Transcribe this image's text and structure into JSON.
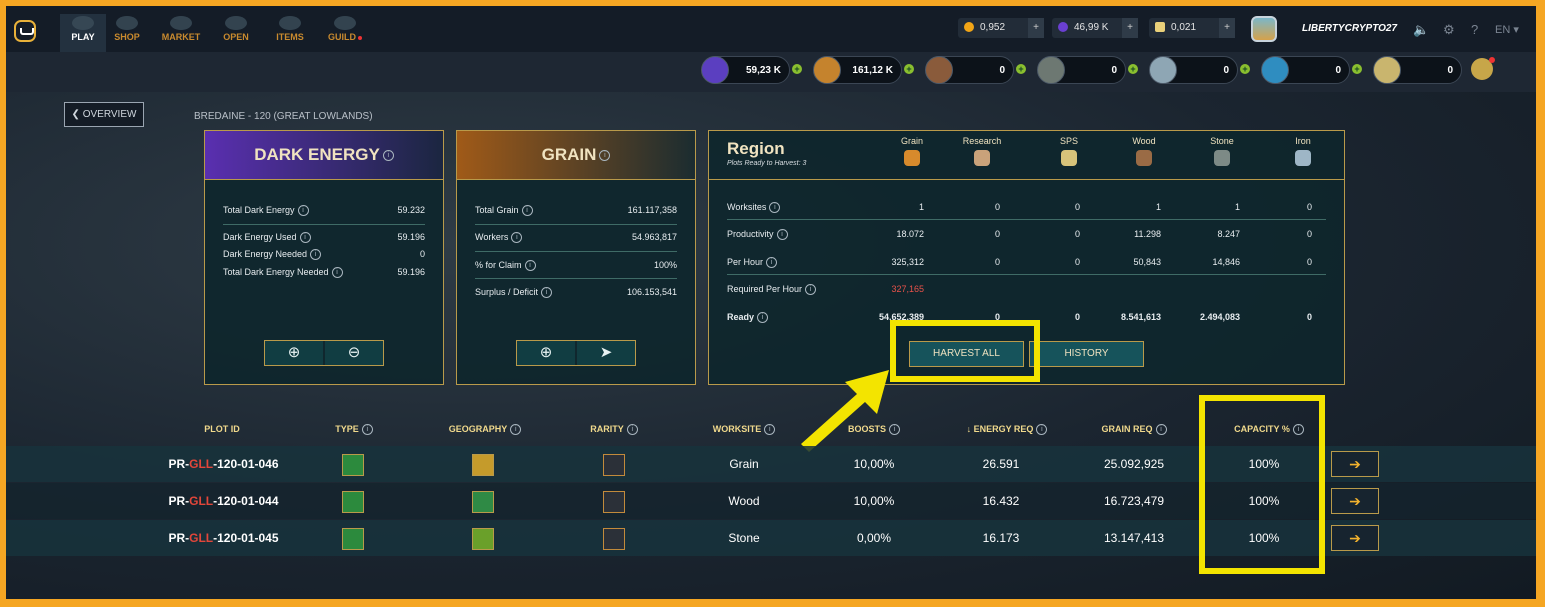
{
  "nav": {
    "items": [
      {
        "label": "PLAY",
        "active": true
      },
      {
        "label": "SHOP"
      },
      {
        "label": "MARKET"
      },
      {
        "label": "OPEN"
      },
      {
        "label": "ITEMS"
      },
      {
        "label": "GUILD"
      }
    ]
  },
  "wallet": {
    "credits": "0,952",
    "dec": "46,99 K",
    "vouchers": "0,021"
  },
  "user": {
    "name": "LIBERTYCRYPTO27",
    "language": "EN"
  },
  "subbar": {
    "back_label": "OVERVIEW",
    "breadcrumb": "BREDAINE - 120 (GREAT LOWLANDS)",
    "resources": [
      {
        "name": "dark-energy",
        "value": "59,23 K",
        "color": "#6b4fd8"
      },
      {
        "name": "grain",
        "value": "161,12 K",
        "color": "#d78a2c"
      },
      {
        "name": "wood",
        "value": "0",
        "color": "#9a6b45"
      },
      {
        "name": "stone",
        "value": "0",
        "color": "#7d8a86"
      },
      {
        "name": "iron",
        "value": "0",
        "color": "#9eb6c6"
      },
      {
        "name": "research",
        "value": "0",
        "color": "#3fa7d9"
      },
      {
        "name": "sps",
        "value": "0",
        "color": "#d7c37a"
      }
    ]
  },
  "dark_energy": {
    "title": "DARK ENERGY",
    "rows": [
      {
        "label": "Total Dark Energy",
        "value": "59.232"
      },
      {
        "label": "Dark Energy Used",
        "value": "59.196"
      },
      {
        "label": "Dark Energy Needed",
        "value": "0"
      },
      {
        "label": "Total Dark Energy Needed",
        "value": "59.196"
      }
    ],
    "buttons": [
      "⊕",
      "⊖"
    ]
  },
  "grain": {
    "title": "GRAIN",
    "rows": [
      {
        "label": "Total Grain",
        "value": "161.117,358"
      },
      {
        "label": "Workers",
        "value": "54.963,817"
      },
      {
        "label": "% for Claim",
        "value": "100%"
      },
      {
        "label": "Surplus / Deficit",
        "value": "106.153,541"
      }
    ],
    "buttons": [
      "⊕",
      "➤"
    ]
  },
  "region": {
    "title": "Region",
    "subtitle": "Plots Ready to Harvest: 3",
    "columns": [
      "Grain",
      "Research",
      "SPS",
      "Wood",
      "Stone",
      "Iron"
    ],
    "column_colors": [
      "#d78a2c",
      "#c9a27a",
      "#d7c37a",
      "#9a6b45",
      "#7d8a86",
      "#9eb6c6"
    ],
    "rows": [
      {
        "label": "Worksites",
        "values": [
          "1",
          "0",
          "0",
          "1",
          "1",
          "0"
        ]
      },
      {
        "label": "Productivity",
        "values": [
          "18.072",
          "0",
          "0",
          "11.298",
          "8.247",
          "0"
        ]
      },
      {
        "label": "Per Hour",
        "values": [
          "325,312",
          "0",
          "0",
          "50,843",
          "14,846",
          "0"
        ]
      },
      {
        "label": "Required Per Hour",
        "values": [
          "327,165",
          "",
          "",
          "",
          "",
          ""
        ]
      },
      {
        "label": "Ready",
        "values": [
          "54.652,389",
          "0",
          "0",
          "8.541,613",
          "2.494,083",
          "0"
        ]
      }
    ],
    "harvest_label": "HARVEST ALL",
    "history_label": "HISTORY"
  },
  "table": {
    "headers": [
      "PLOT ID",
      "TYPE",
      "GEOGRAPHY",
      "RARITY",
      "WORKSITE",
      "BOOSTS",
      "ENERGY REQ",
      "GRAIN REQ",
      "CAPACITY %"
    ],
    "sort_arrow": "↓",
    "rows": [
      {
        "prefix": "PR-",
        "region": "GLL",
        "suffix": "-120-01-046",
        "worksite": "Grain",
        "boosts": "10,00%",
        "energy": "26.591",
        "grain": "25.092,925",
        "capacity": "100%",
        "geo_color": "#c59b2b"
      },
      {
        "prefix": "PR-",
        "region": "GLL",
        "suffix": "-120-01-044",
        "worksite": "Wood",
        "boosts": "10,00%",
        "energy": "16.432",
        "grain": "16.723,479",
        "capacity": "100%",
        "geo_color": "#2f8a45"
      },
      {
        "prefix": "PR-",
        "region": "GLL",
        "suffix": "-120-01-045",
        "worksite": "Stone",
        "boosts": "0,00%",
        "energy": "16.173",
        "grain": "13.147,413",
        "capacity": "100%",
        "geo_color": "#6aa02a"
      }
    ]
  }
}
